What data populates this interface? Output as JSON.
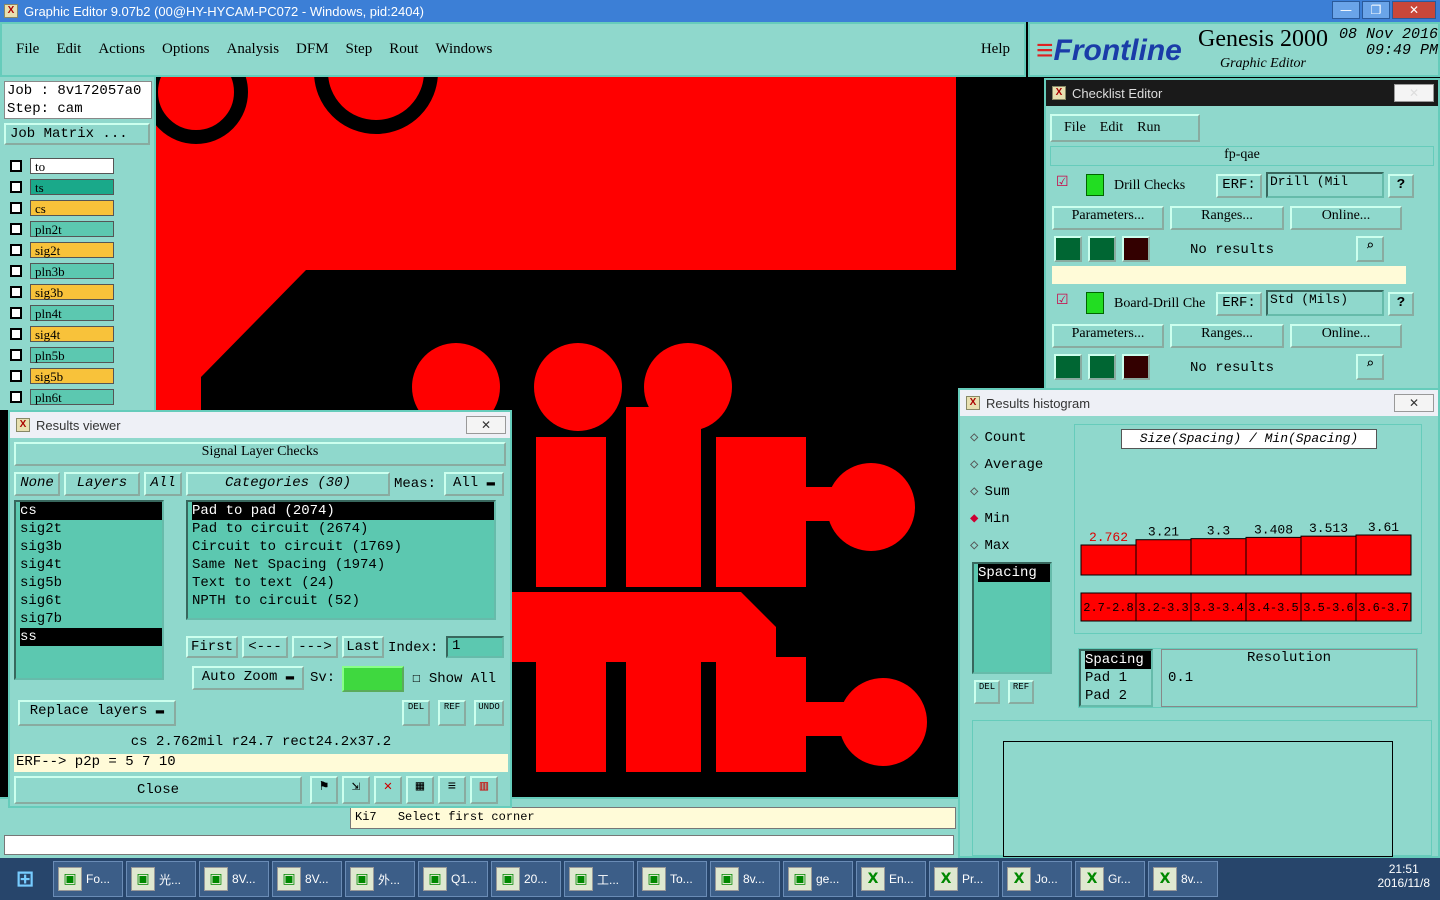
{
  "app": {
    "title": "Graphic Editor 9.07b2 (00@HY-HYCAM-PC072 - Windows, pid:2404)",
    "controls": [
      "—",
      "❐",
      "✕"
    ]
  },
  "menu": {
    "items": [
      "File",
      "Edit",
      "Actions",
      "Options",
      "Analysis",
      "DFM",
      "Step",
      "Rout",
      "Windows"
    ],
    "help": "Help"
  },
  "brand": {
    "logo": "Frontline",
    "product": "Genesis 2000",
    "subtitle": "Graphic Editor",
    "date": "08 Nov 2016",
    "time": "09:49 PM"
  },
  "job": {
    "job_label": "Job : 8v172057a0",
    "step_label": "Step: cam",
    "matrix_button": "Job Matrix ..."
  },
  "layers": [
    {
      "name": "to",
      "bg": "#ffffff",
      "mark": ""
    },
    {
      "name": "ts",
      "bg": "#1aa98a",
      "mark": ""
    },
    {
      "name": "cs",
      "bg": "#f8c23a",
      "mark": "■"
    },
    {
      "name": "pln2t",
      "bg": "#5cc8b0",
      "mark": ""
    },
    {
      "name": "sig2t",
      "bg": "#f8c23a",
      "mark": ""
    },
    {
      "name": "pln3b",
      "bg": "#5cc8b0",
      "mark": ""
    },
    {
      "name": "sig3b",
      "bg": "#f8c23a",
      "mark": ""
    },
    {
      "name": "pln4t",
      "bg": "#5cc8b0",
      "mark": ""
    },
    {
      "name": "sig4t",
      "bg": "#f8c23a",
      "mark": ""
    },
    {
      "name": "pln5b",
      "bg": "#5cc8b0",
      "mark": ""
    },
    {
      "name": "sig5b",
      "bg": "#f8c23a",
      "mark": ""
    },
    {
      "name": "pln6t",
      "bg": "#5cc8b0",
      "mark": ""
    },
    {
      "name": "sig6t",
      "bg": "#f8c23a",
      "mark": ""
    }
  ],
  "results_viewer": {
    "title": "Results viewer",
    "close_x": "✕",
    "header": "Signal Layer Checks",
    "none_btn": "None",
    "layers_btn": "Layers",
    "all_btn": "All",
    "categories_btn": "Categories (30)",
    "meas_label": "Meas:",
    "meas_value": "All",
    "layer_list": [
      "cs",
      "sig2t",
      "sig3b",
      "sig4t",
      "sig5b",
      "sig6t",
      "sig7b",
      "ss"
    ],
    "category_list": [
      "Pad to pad (2074)",
      "Pad to circuit (2674)",
      "Circuit to circuit (1769)",
      "Same Net Spacing (1974)",
      "Text to text (24)",
      "NPTH to circuit (52)"
    ],
    "first": "First",
    "prev": "<---",
    "next": "--->",
    "last": "Last",
    "index_label": "Index:",
    "index_value": "1",
    "auto_zoom": "Auto Zoom",
    "sv_label": "Sv:",
    "show_all": "Show All",
    "replace_layers": "Replace layers",
    "del": "DEL",
    "ref": "REF",
    "undo": "UNDO",
    "status": "cs 2.762mil  r24.7  rect24.2x37.2",
    "erf": "ERF--> p2p = 5 7 10",
    "close": "Close"
  },
  "status_bar": {
    "hint": "Select first corner",
    "prefix": "Ki7"
  },
  "checklist": {
    "title": "Checklist Editor",
    "menu": [
      "File",
      "Edit",
      "Run"
    ],
    "name": "fp-qae",
    "checks": [
      {
        "name": "Drill Checks",
        "erf_label": "ERF:",
        "erf_value": "Drill (Mil",
        "help": "?",
        "params": "Parameters...",
        "ranges": "Ranges...",
        "online": "Online...",
        "result": "No results"
      },
      {
        "name": "Board-Drill Che",
        "erf_label": "ERF:",
        "erf_value": "Std (Mils)",
        "help": "?",
        "params": "Parameters...",
        "ranges": "Ranges...",
        "online": "Online...",
        "result": "No results"
      }
    ]
  },
  "histogram": {
    "title": "Results histogram",
    "options": [
      {
        "label": "Count",
        "selected": false
      },
      {
        "label": "Average",
        "selected": false
      },
      {
        "label": "Sum",
        "selected": false
      },
      {
        "label": "Min",
        "selected": true
      },
      {
        "label": "Max",
        "selected": false
      }
    ],
    "list_item": "Spacing",
    "heading": "Size(Spacing) / Min(Spacing)",
    "del": "DEL",
    "ref": "REF",
    "bottom_list": [
      "Spacing",
      "Pad 1",
      "Pad 2"
    ],
    "resolution_label": "Resolution",
    "resolution_value": "0.1",
    "chart_data": {
      "type": "bar",
      "categories": [
        "2.7-2.8",
        "3.2-3.3",
        "3.3-3.4",
        "3.4-3.5",
        "3.5-3.6",
        "3.6-3.7"
      ],
      "values": [
        2.762,
        3.21,
        3.3,
        3.408,
        3.513,
        3.61
      ],
      "value_labels": [
        "2.762",
        "3.21",
        "3.3",
        "3.408",
        "3.513",
        "3.61"
      ]
    }
  },
  "taskbar": {
    "items": [
      "Fo...",
      "光...",
      "8V...",
      "8V...",
      "外...",
      "Q1...",
      "20...",
      "工...",
      "To...",
      "8v...",
      "ge...",
      "En...",
      "Pr...",
      "Jo...",
      "Gr...",
      "8v..."
    ],
    "time": "21:51",
    "date": "2016/11/8"
  },
  "colors": {
    "panel": "#8fd8cc",
    "copper": "#ff0000",
    "background": "#000000",
    "title_bar": "#3c7fd6"
  }
}
